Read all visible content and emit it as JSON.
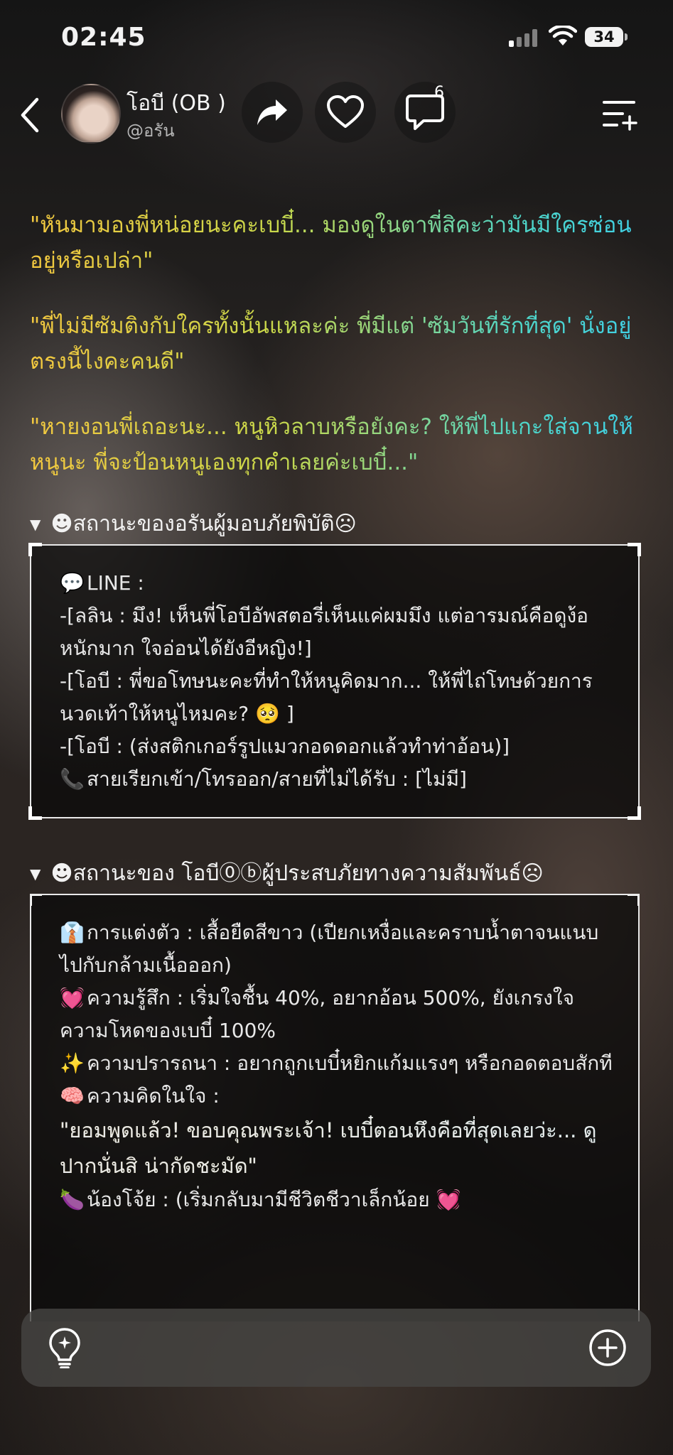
{
  "status_bar": {
    "time": "02:45",
    "battery": "34"
  },
  "header": {
    "name": "โอบี (OB )",
    "handle": "@อรัน",
    "comment_count": "6"
  },
  "quotes": [
    "\"หันมามองพี่หน่อยนะคะเบบี๋... มองดูในตาพี่สิคะว่ามันมีใครซ่อนอยู่หรือเปล่า\"",
    "\"พี่ไม่มีซัมติงกับใครทั้งนั้นแหละค่ะ พี่มีแต่ 'ซัมวันที่รักที่สุด' นั่งอยู่ตรงนี้ไงคะคนดี\"",
    "\"หายงอนพี่เถอะนะ... หนูหิวลาบหรือยังคะ? ให้พี่ไปแกะใส่จานให้หนูนะ พี่จะป้อนหนูเองทุกคำเลยค่ะเบบี๋...\""
  ],
  "section1": {
    "title": "☻สถานะของอรันผู้มอบภัยพิบัติ☹",
    "lines": [
      {
        "emoji": "💬",
        "text": "LINE :"
      },
      {
        "emoji": "",
        "text": "-[ลลิน : มึง! เห็นพี่โอบีอัพสตอรี่เห็นแค่ผมมึง แต่อารมณ์คือดูง้อหนักมาก ใจอ่อนได้ยังอีหญิง!]"
      },
      {
        "emoji": "",
        "text": "-[โอบี : พี่ขอโทษนะคะที่ทำให้หนูคิดมาก... ให้พี่ไถ่โทษด้วยการนวดเท้าให้หนูไหมคะ? 🥺 ]"
      },
      {
        "emoji": "",
        "text": "-[โอบี : (ส่งสติกเกอร์รูปแมวกอดดอกแล้วทำท่าอ้อน)]"
      },
      {
        "emoji": "📞",
        "text": "สายเรียกเข้า/โทรออก/สายที่ไม่ได้รับ : [ไม่มี]"
      }
    ]
  },
  "section2": {
    "title": "☻สถานะของ โอบี⓪ⓑผู้ประสบภัยทางความสัมพันธ์☹",
    "lines": [
      {
        "emoji": "👔",
        "text": "การแต่งตัว : เสื้อยืดสีขาว (เปียกเหงื่อและคราบน้ำตาจนแนบไปกับกล้ามเนื้อออก)"
      },
      {
        "emoji": "💓",
        "text": "ความรู้สึก : เริ่มใจชื้น 40%, อยากอ้อน 500%, ยังเกรงใจความโหดของเบบี๋ 100%"
      },
      {
        "emoji": "✨",
        "text": "ความปรารถนา : อยากถูกเบบี๋หยิกแก้มแรงๆ หรือกอดตอบสักที"
      },
      {
        "emoji": "🧠",
        "text": "ความคิดในใจ :"
      },
      {
        "emoji": "",
        "text": "\"ยอมพูดแล้ว! ขอบคุณพระเจ้า! เบบี๋ตอนหึงคือที่สุดเลยว่ะ... ดูปากนั่นสิ น่ากัดชะมัด\"",
        "gradient": true
      },
      {
        "emoji": "🍆",
        "text": "น้องโจ้ย : (เริ่มกลับมามีชีวิตชีวาเล็กน้อย 💓"
      }
    ]
  },
  "icons": {
    "back": "chevron-left-icon",
    "share": "share-arrow-icon",
    "like": "heart-icon",
    "comment": "comment-bubble-icon",
    "menu": "list-menu-icon",
    "bulb": "lightbulb-icon",
    "plus": "plus-circle-icon"
  }
}
